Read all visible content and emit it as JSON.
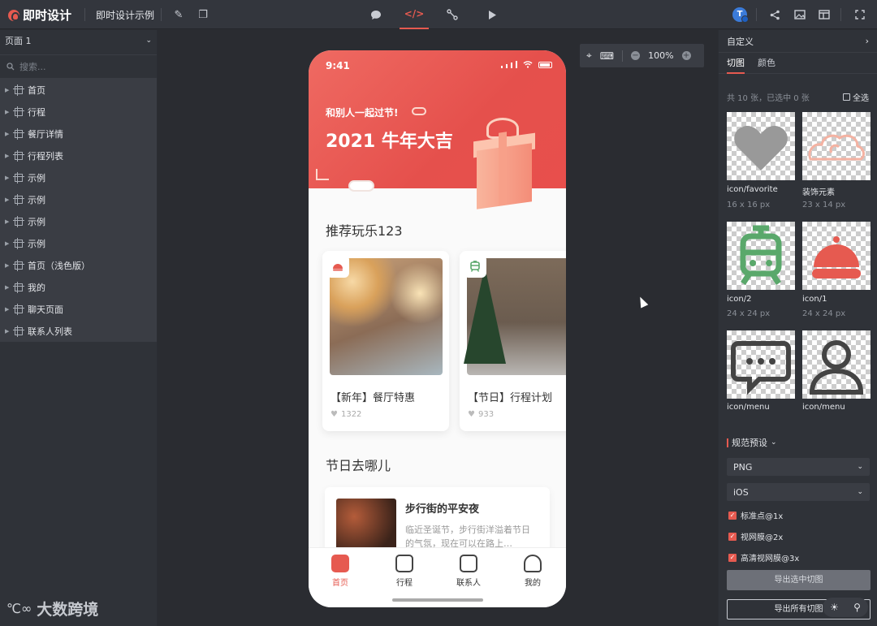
{
  "app": {
    "logo_text": "即时设计",
    "project_name": "即时设计示例"
  },
  "toolbar": {
    "avatar_letter": "T"
  },
  "left_panel": {
    "page_selector": "页面 1",
    "search_placeholder": "搜索...",
    "layers": [
      "首页",
      "行程",
      "餐厅详情",
      "行程列表",
      "示例",
      "示例",
      "示例",
      "示例",
      "首页（浅色版）",
      "我的",
      "聊天页面",
      "联系人列表"
    ]
  },
  "canvas": {
    "zoom": "100%"
  },
  "phone": {
    "status_time": "9:41",
    "hero_subtitle": "和别人一起过节!",
    "hero_title": "2021 牛年大吉",
    "section1_title": "推荐玩乐123",
    "cards": [
      {
        "title": "【新年】餐厅特惠",
        "likes": "1322"
      },
      {
        "title": "【节日】行程计划",
        "likes": "933"
      }
    ],
    "section2_title": "节日去哪儿",
    "list_item": {
      "title": "步行街的平安夜",
      "desc": "临近圣诞节，步行街洋溢着节日的气氛，现在可以在路上…"
    },
    "tabs": [
      "首页",
      "行程",
      "联系人",
      "我的"
    ]
  },
  "right_panel": {
    "header": "自定义",
    "tabs": [
      "切图",
      "颜色"
    ],
    "count_text": "共 10 张，已选中 0 张",
    "select_all": "全选",
    "assets": [
      {
        "name": "icon/favorite",
        "size": "16 x 16 px"
      },
      {
        "name": "装饰元素",
        "size": "23 x 14 px"
      },
      {
        "name": "icon/2",
        "size": "24 x 24 px"
      },
      {
        "name": "icon/1",
        "size": "24 x 24 px"
      },
      {
        "name": "icon/menu",
        "size": ""
      },
      {
        "name": "icon/menu",
        "size": ""
      }
    ],
    "spec_title": "规范预设",
    "format": "PNG",
    "platform": "iOS",
    "scales": [
      "标准点@1x",
      "视网膜@2x",
      "高清视网膜@3x"
    ],
    "export_selected": "导出选中切图",
    "export_all": "导出所有切图"
  },
  "watermark": {
    "text": "大数跨境"
  },
  "colors": {
    "accent": "#e65a50",
    "favorite_gray": "#999999",
    "tram_green": "#5aa86b",
    "hat_red": "#e65a50"
  }
}
